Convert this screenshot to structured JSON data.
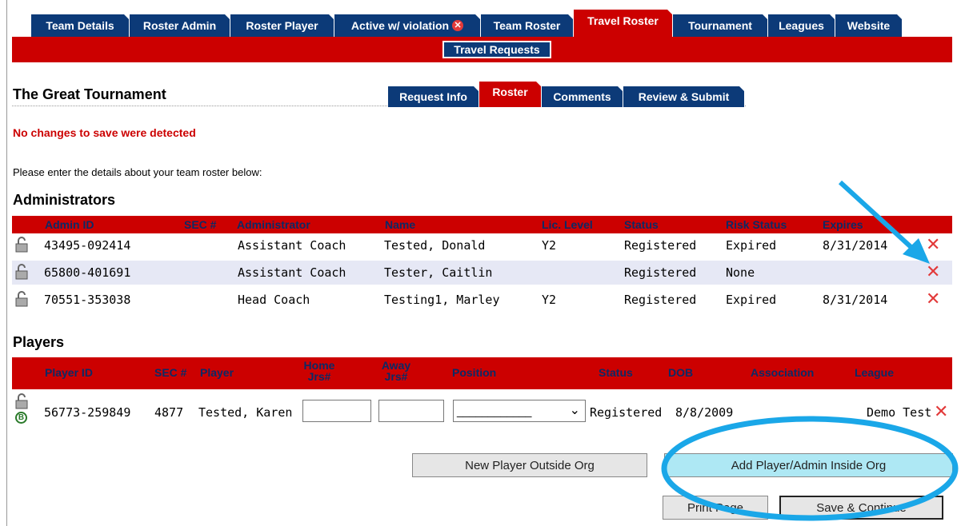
{
  "top_tabs": [
    {
      "label": "Team Details"
    },
    {
      "label": "Roster Admin"
    },
    {
      "label": "Roster Player"
    },
    {
      "label": "Active w/ violation"
    },
    {
      "label": "Team Roster"
    },
    {
      "label": "Travel Roster"
    },
    {
      "label": "Tournament"
    },
    {
      "label": "Leagues"
    },
    {
      "label": "Website"
    }
  ],
  "subnav": {
    "label": "Travel Requests"
  },
  "page": {
    "title": "The Great Tournament",
    "tabs": [
      {
        "label": "Request Info"
      },
      {
        "label": "Roster"
      },
      {
        "label": "Comments"
      },
      {
        "label": "Review & Submit"
      }
    ],
    "message": "No changes to save were detected",
    "instructions": "Please enter the details about your team roster below:"
  },
  "administrators": {
    "heading": "Administrators",
    "columns": [
      "Admin ID",
      "SEC #",
      "Administrator",
      "Name",
      "Lic. Level",
      "Status",
      "Risk Status",
      "Expires"
    ],
    "rows": [
      {
        "admin_id": "43495-092414",
        "sec": "",
        "role": "Assistant Coach",
        "name": "Tested, Donald",
        "lic": "Y2",
        "status": "Registered",
        "risk": "Expired",
        "expires": "8/31/2014"
      },
      {
        "admin_id": "65800-401691",
        "sec": "",
        "role": "Assistant Coach",
        "name": "Tester, Caitlin",
        "lic": "",
        "status": "Registered",
        "risk": "None",
        "expires": ""
      },
      {
        "admin_id": "70551-353038",
        "sec": "",
        "role": "Head Coach",
        "name": "Testing1, Marley",
        "lic": "Y2",
        "status": "Registered",
        "risk": "Expired",
        "expires": "8/31/2014"
      }
    ]
  },
  "players": {
    "heading": "Players",
    "columns": [
      "Player ID",
      "SEC #",
      "Player",
      "Home Jrs#",
      "Away Jrs#",
      "Position",
      "Status",
      "DOB",
      "Association",
      "League"
    ],
    "rows": [
      {
        "player_id": "56773-259849",
        "sec": "4877",
        "name": "Tested, Karen",
        "home": "",
        "away": "",
        "position": "____________",
        "status": "Registered",
        "dob": "8/8/2009",
        "association": "",
        "league": "Demo Test"
      }
    ]
  },
  "buttons": {
    "new_outside": "New Player Outside Org",
    "add_inside": "Add Player/Admin Inside Org",
    "print": "Print Page",
    "save": "Save & Continue"
  },
  "badge_letter": "B",
  "colors": {
    "nav_blue": "#0c3a78",
    "red": "#cc0000",
    "header_text": "#0c2a66",
    "annotation": "#1aa7e8"
  }
}
